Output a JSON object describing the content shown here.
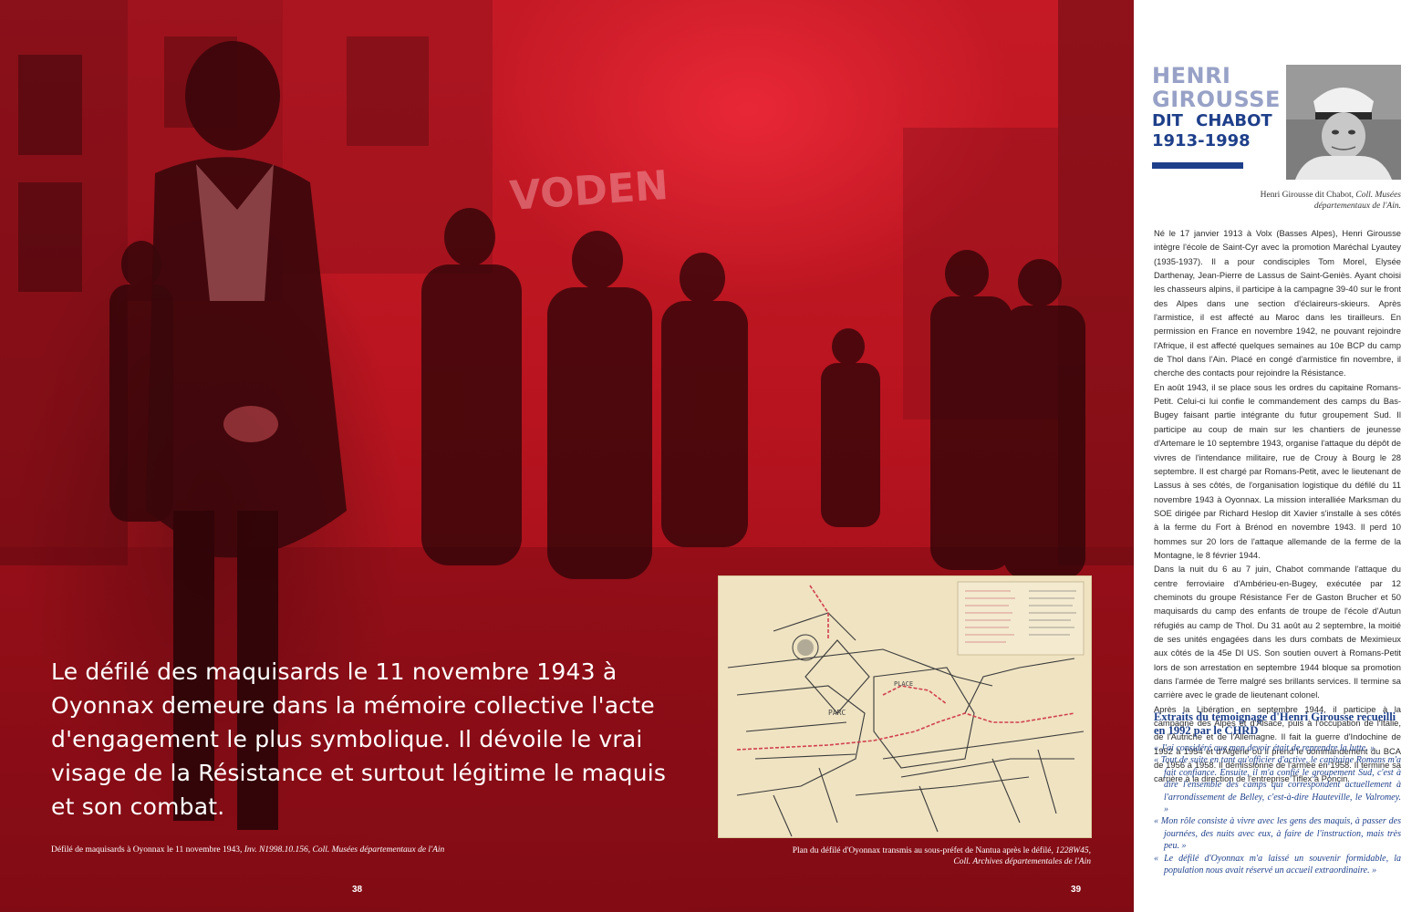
{
  "colors": {
    "overlay_red": "#c51a26",
    "navy": "#1e3f8a",
    "title_light": "#98a2c7"
  },
  "left_page": {
    "quote": "Le défilé des maquisards le 11 novembre 1943 à Oyonnax demeure dans la mémoire collective l'acte d'engagement le plus symbolique. Il dévoile le vrai visage de la Résistance et surtout légitime le maquis et son combat.",
    "caption": {
      "text": "Défilé de maquisards à Oyonnax le 11 novembre 1943, ",
      "inv": "Inv. N1998.10.156, Coll. Musées départementaux de l'Ain"
    },
    "page_number": "38"
  },
  "right_page": {
    "page_number": "39",
    "map_caption": {
      "line1": "Plan du défilé d'Oyonnax transmis au sous-préfet de Nantua après le défilé, ",
      "line1_ref": "1228W45,",
      "line2": "Coll. Archives départementales de l'Ain"
    },
    "map_labels": {
      "parc": "PARC",
      "place": "PLACE"
    }
  },
  "sidebar": {
    "title_line1": "HENRI",
    "title_line2": "GIROUSSE",
    "subtitle": "DIT CHABOT",
    "dates": "1913-1998",
    "portrait_icon": "portrait-photo-icon",
    "portrait_caption": "Henri Girousse dit Chabot, ",
    "portrait_caption_italic": "Coll. Musées départementaux de l'Ain.",
    "bio": [
      "Né le 17 janvier 1913 à Volx (Basses Alpes), Henri Girousse intègre l'école de Saint-Cyr avec la promotion Maréchal Lyautey (1935-1937). Il a pour condisciples Tom Morel, Elysée Darthenay, Jean-Pierre de Lassus de Saint-Geniès. Ayant choisi les chasseurs alpins, il participe à la campagne 39-40 sur le front des Alpes dans une section d'éclaireurs-skieurs. Après l'armistice, il est affecté au Maroc dans les tirailleurs. En permission en France en novembre 1942, ne pouvant rejoindre l'Afrique, il est affecté quelques semaines au 10e BCP du camp de Thol dans l'Ain. Placé en congé d'armistice fin novembre, il cherche des contacts pour rejoindre la Résistance.",
      "En août 1943, il se place sous les ordres du capitaine Romans-Petit. Celui-ci lui confie le commandement des camps du Bas-Bugey faisant partie intégrante du futur groupement Sud. Il participe au coup de main sur les chantiers de jeunesse d'Artemare le 10 septembre 1943, organise l'attaque du dépôt de vivres de l'intendance militaire, rue de Crouy à Bourg le 28 septembre. Il est chargé par Romans-Petit, avec le lieutenant de Lassus à ses côtés, de l'organisation logistique du défilé du 11 novembre 1943 à Oyonnax. La mission interalliée Marksman du SOE dirigée par Richard Heslop dit Xavier s'installe à ses côtés à la ferme du Fort à Brénod en novembre 1943. Il perd 10 hommes sur 20 lors de l'attaque allemande de la ferme de la Montagne, le 8 février 1944.",
      "Dans la nuit du 6 au 7 juin, Chabot commande l'attaque du centre ferroviaire d'Ambérieu-en-Bugey, exécutée par 12 cheminots du groupe Résistance Fer de Gaston Brucher et 50 maquisards du camp des enfants de troupe de l'école d'Autun réfugiés au camp de Thol. Du 31 août au 2 septembre, la moitié de ses unités engagées dans les durs combats de Meximieux aux côtés de la 45e DI US. Son soutien ouvert à Romans-Petit lors de son arrestation en septembre 1944 bloque sa promotion dans l'armée de Terre malgré ses brillants services. Il termine sa carrière avec le grade de lieutenant colonel.",
      "Après la Libération en septembre 1944, il participe à la campagne des Alpes et d'Alsace, puis à l'occupation de l'Italie, de l'Autriche et de l'Allemagne. Il fait la guerre d'Indochine de 1952 à 1954 et d'Algérie où il prend le commandement du BCA de 1956 à 1958. Il démissionne de l'armée en 1958. Il termine sa carrière à la direction de l'entreprise Tiflex à Poncin."
    ],
    "extracts_title": "Extraits du témoignage d'Henri Girousse recueilli en 1992 par le CHRD",
    "extracts": [
      "« J'ai considéré que mon devoir était de reprendre la lutte. »",
      "« Tout de suite en tant qu'officier d'active, le capitaine Romans m'a fait confiance. Ensuite, il m'a confié le groupement Sud, c'est à dire l'ensemble des camps qui correspondent actuellement à l'arrondissement de Belley, c'est-à-dire Hauteville, le Valromey. »",
      "« Mon rôle consiste à vivre avec les gens des maquis, à passer des journées, des nuits avec eux, à faire de l'instruction, mais très peu. »",
      "« Le défilé d'Oyonnax m'a laissé un souvenir formidable, la population nous avait réservé un accueil extraordinaire. »"
    ]
  }
}
